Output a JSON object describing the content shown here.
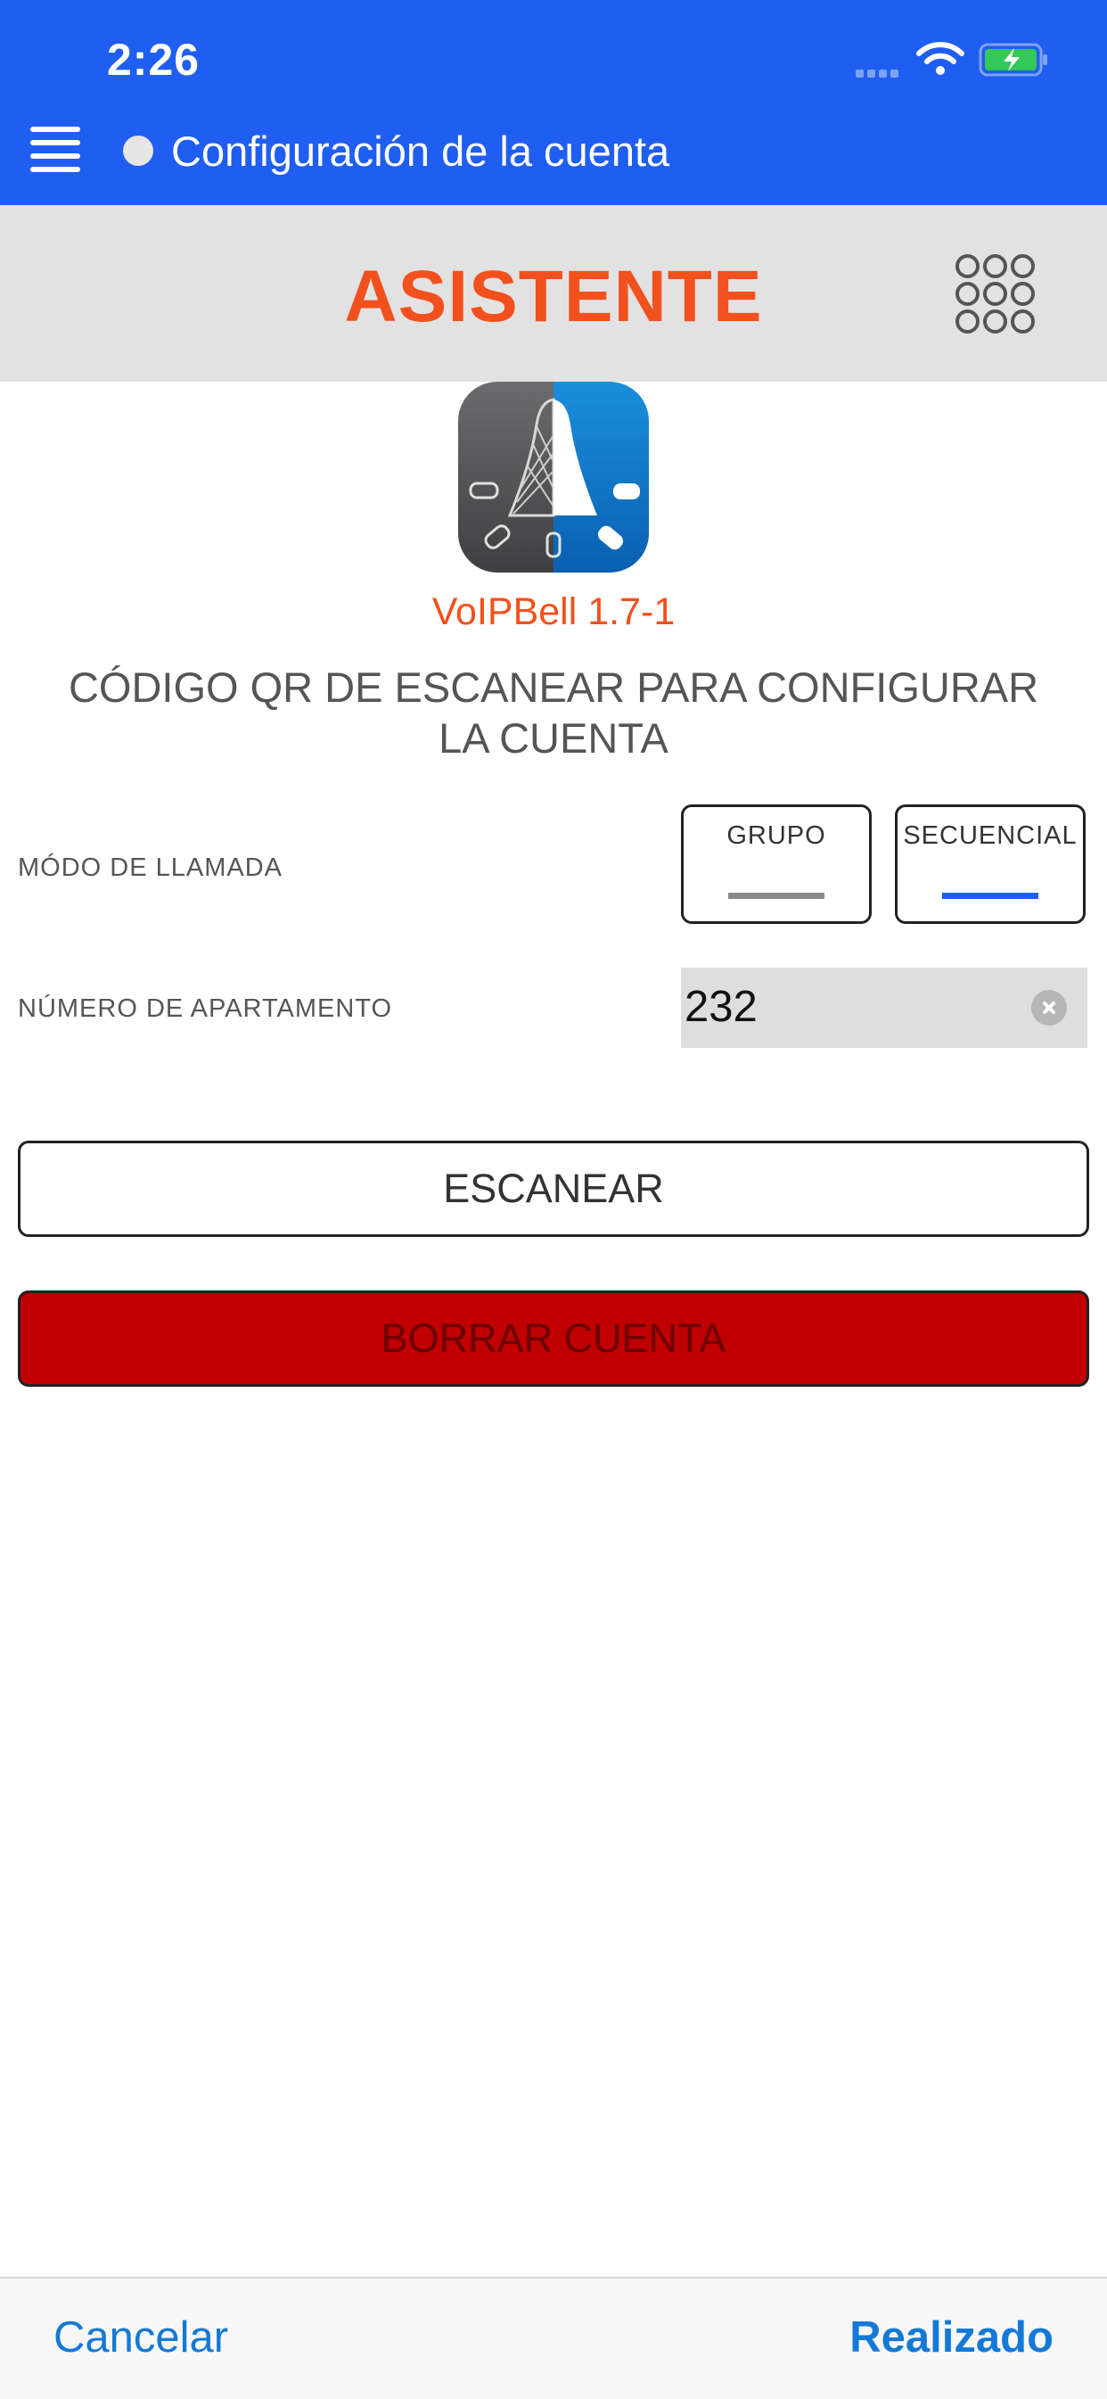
{
  "status_bar": {
    "time": "2:26"
  },
  "nav": {
    "title": "Configuración de la cuenta"
  },
  "header": {
    "title": "ASISTENTE"
  },
  "app": {
    "version": "VoIPBell 1.7-1"
  },
  "main": {
    "instruction": "CÓDIGO QR DE ESCANEAR PARA CONFIGURAR LA CUENTA",
    "call_mode": {
      "label": "MÓDO DE LLAMADA",
      "options": [
        "GRUPO",
        "SECUENCIAL"
      ],
      "selected": "SECUENCIAL"
    },
    "apartment": {
      "label": "NÚMERO DE APARTAMENTO",
      "value": "232"
    },
    "scan_label": "ESCANEAR",
    "delete_label": "BORRAR CUENTA"
  },
  "footer": {
    "cancel_label": "Cancelar",
    "done_label": "Realizado"
  },
  "colors": {
    "nav_blue": "#1f5ef0",
    "accent_orange": "#f2501d",
    "delete_red": "#c00000",
    "link_blue": "#1479d6",
    "selected_bar": "#1f5ef0",
    "unselected_bar": "#8a8a8a"
  }
}
